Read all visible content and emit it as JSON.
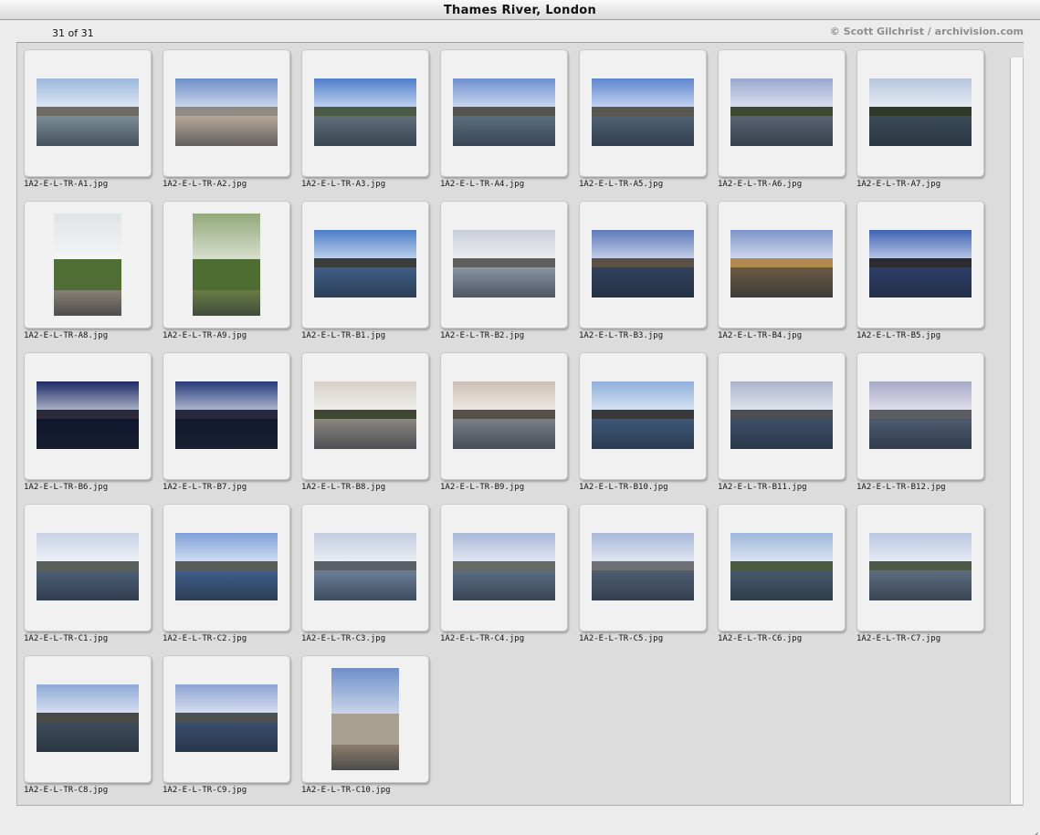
{
  "window": {
    "title": "Thames River, London"
  },
  "header": {
    "count": "31 of 31",
    "credit": "© Scott Gilchrist / archivision.com"
  },
  "icons": {
    "resize": "resize-grip-icon"
  },
  "images": [
    {
      "file": "1A2-E-L-TR-A1.jpg",
      "orientation": "landscape",
      "sky": "#9cb8dc",
      "land": "#6f6a62",
      "water": "#7a8d96"
    },
    {
      "file": "1A2-E-L-TR-A2.jpg",
      "orientation": "landscape",
      "sky": "#6f8fc9",
      "land": "#8f8a82",
      "water": "#b8a89a"
    },
    {
      "file": "1A2-E-L-TR-A3.jpg",
      "orientation": "landscape",
      "sky": "#4f7fcb",
      "land": "#4a5a44",
      "water": "#5e6e7b"
    },
    {
      "file": "1A2-E-L-TR-A4.jpg",
      "orientation": "landscape",
      "sky": "#6e90cf",
      "land": "#56544e",
      "water": "#5b6e80"
    },
    {
      "file": "1A2-E-L-TR-A5.jpg",
      "orientation": "landscape",
      "sky": "#5e86d0",
      "land": "#5a5850",
      "water": "#4e6275"
    },
    {
      "file": "1A2-E-L-TR-A6.jpg",
      "orientation": "landscape",
      "sky": "#9aa8cf",
      "land": "#3d4a33",
      "water": "#5a6372"
    },
    {
      "file": "1A2-E-L-TR-A7.jpg",
      "orientation": "landscape",
      "sky": "#b8c6de",
      "land": "#2f3a28",
      "water": "#3b4b58"
    },
    {
      "file": "1A2-E-L-TR-A8.jpg",
      "orientation": "portrait",
      "sky": "#dfe4e6",
      "land": "#4f6e34",
      "water": "#8a8074"
    },
    {
      "file": "1A2-E-L-TR-A9.jpg",
      "orientation": "portrait",
      "sky": "#93a97a",
      "land": "#4d6d32",
      "water": "#6a7d47"
    },
    {
      "file": "1A2-E-L-TR-B1.jpg",
      "orientation": "landscape",
      "sky": "#4c7cc8",
      "land": "#3a3e3a",
      "water": "#3f5e86"
    },
    {
      "file": "1A2-E-L-TR-B2.jpg",
      "orientation": "landscape",
      "sky": "#c9ced8",
      "land": "#5e605e",
      "water": "#8a95a4"
    },
    {
      "file": "1A2-E-L-TR-B3.jpg",
      "orientation": "landscape",
      "sky": "#5d79b9",
      "land": "#5a5046",
      "water": "#2f425d"
    },
    {
      "file": "1A2-E-L-TR-B4.jpg",
      "orientation": "landscape",
      "sky": "#7d94c8",
      "land": "#b38a4e",
      "water": "#6a5a44"
    },
    {
      "file": "1A2-E-L-TR-B5.jpg",
      "orientation": "landscape",
      "sky": "#3e62b3",
      "land": "#2c2c30",
      "water": "#2d3e68"
    },
    {
      "file": "1A2-E-L-TR-B6.jpg",
      "orientation": "landscape",
      "sky": "#1c2a66",
      "land": "#2a2a3a",
      "water": "#10162e"
    },
    {
      "file": "1A2-E-L-TR-B7.jpg",
      "orientation": "landscape",
      "sky": "#243a7a",
      "land": "#262a3e",
      "water": "#121a30"
    },
    {
      "file": "1A2-E-L-TR-B8.jpg",
      "orientation": "landscape",
      "sky": "#d6d0c8",
      "land": "#3f4632",
      "water": "#8c8680"
    },
    {
      "file": "1A2-E-L-TR-B9.jpg",
      "orientation": "landscape",
      "sky": "#cdbfb4",
      "land": "#56504a",
      "water": "#7a8088"
    },
    {
      "file": "1A2-E-L-TR-B10.jpg",
      "orientation": "landscape",
      "sky": "#8fb0dc",
      "land": "#36383a",
      "water": "#3e5878"
    },
    {
      "file": "1A2-E-L-TR-B11.jpg",
      "orientation": "landscape",
      "sky": "#aab4cc",
      "land": "#4a4e50",
      "water": "#3d5068"
    },
    {
      "file": "1A2-E-L-TR-B12.jpg",
      "orientation": "landscape",
      "sky": "#a8a9c8",
      "land": "#5a5e60",
      "water": "#4c5b70"
    },
    {
      "file": "1A2-E-L-TR-C1.jpg",
      "orientation": "landscape",
      "sky": "#c9d3e6",
      "land": "#5b5f5a",
      "water": "#4c5e76"
    },
    {
      "file": "1A2-E-L-TR-C2.jpg",
      "orientation": "landscape",
      "sky": "#7fa0d8",
      "land": "#5a5c5a",
      "water": "#3f5e88"
    },
    {
      "file": "1A2-E-L-TR-C3.jpg",
      "orientation": "landscape",
      "sky": "#c2cde0",
      "land": "#5a6068",
      "water": "#6a7f98"
    },
    {
      "file": "1A2-E-L-TR-C4.jpg",
      "orientation": "landscape",
      "sky": "#aab9d8",
      "land": "#686a66",
      "water": "#5b6e84"
    },
    {
      "file": "1A2-E-L-TR-C5.jpg",
      "orientation": "landscape",
      "sky": "#a9b9d9",
      "land": "#6e7274",
      "water": "#4f6072"
    },
    {
      "file": "1A2-E-L-TR-C6.jpg",
      "orientation": "landscape",
      "sky": "#9db6dc",
      "land": "#4c5a40",
      "water": "#475a6c"
    },
    {
      "file": "1A2-E-L-TR-C7.jpg",
      "orientation": "landscape",
      "sky": "#b9c7e0",
      "land": "#4d5846",
      "water": "#5d6d80"
    },
    {
      "file": "1A2-E-L-TR-C8.jpg",
      "orientation": "landscape",
      "sky": "#8ea9d6",
      "land": "#4a4a44",
      "water": "#3f4c5a"
    },
    {
      "file": "1A2-E-L-TR-C9.jpg",
      "orientation": "landscape",
      "sky": "#8ea4d4",
      "land": "#4d5050",
      "water": "#3a4e6e"
    },
    {
      "file": "1A2-E-L-TR-C10.jpg",
      "orientation": "portrait",
      "sky": "#6f8ec8",
      "land": "#a8a090",
      "water": "#8b7e6c"
    }
  ]
}
